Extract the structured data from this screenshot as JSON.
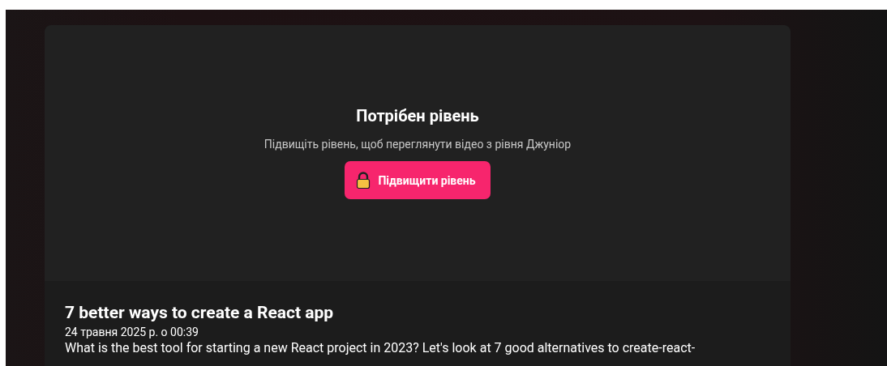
{
  "locked_video": {
    "title": "Потрібен рівень",
    "message": "Підвищіть рівень, щоб переглянути відео з рівня Джуніор",
    "button": "Підвищити рівень"
  },
  "post": {
    "title": "7 better ways to create a React app",
    "date": "24 травня 2025 р. о 00:39",
    "excerpt": "What is the best tool for starting a new React project in 2023? Let's look at 7 good alternatives to create-react-"
  }
}
